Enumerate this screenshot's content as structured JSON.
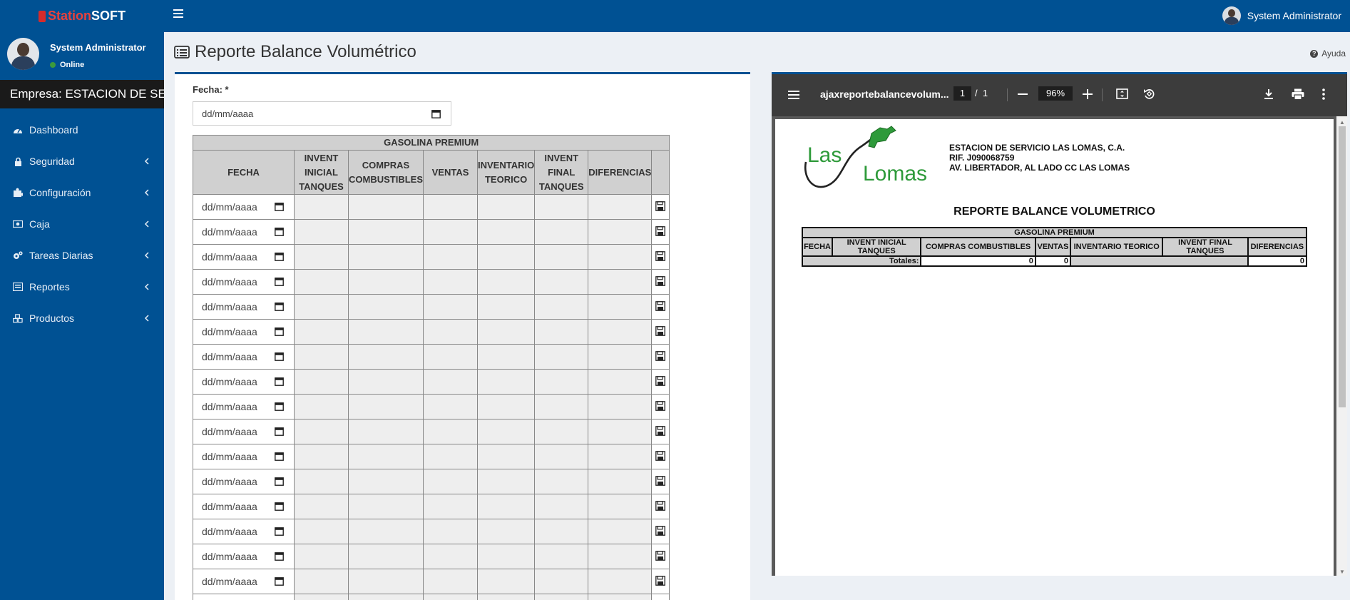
{
  "brand": {
    "logo_part1": "Station",
    "logo_part2": "SOFT"
  },
  "header": {
    "user_name": "System Administrator"
  },
  "sidebar": {
    "user_name": "System Administrator",
    "status": "Online",
    "empresa": "Empresa: ESTACION DE SERVICIO LAS LOMAS, C.A.",
    "items": [
      {
        "label": "Dashboard",
        "icon": "dashboard-icon",
        "has_submenu": false
      },
      {
        "label": "Seguridad",
        "icon": "lock-icon",
        "has_submenu": true
      },
      {
        "label": "Configuración",
        "icon": "puzzle-icon",
        "has_submenu": true
      },
      {
        "label": "Caja",
        "icon": "money-icon",
        "has_submenu": true
      },
      {
        "label": "Tareas Diarias",
        "icon": "cogs-icon",
        "has_submenu": true
      },
      {
        "label": "Reportes",
        "icon": "list-alt-icon",
        "has_submenu": true
      },
      {
        "label": "Productos",
        "icon": "cubes-icon",
        "has_submenu": true
      }
    ]
  },
  "page": {
    "title": "Reporte Balance Volumétrico",
    "help_label": "Ayuda"
  },
  "form": {
    "fecha_label": "Fecha: *",
    "fecha_placeholder": "dd/mm/aaaa"
  },
  "table": {
    "group_title": "GASOLINA PREMIUM",
    "columns": [
      "FECHA",
      "INVENT INICIAL TANQUES",
      "COMPRAS COMBUSTIBLES",
      "VENTAS",
      "INVENTARIO TEORICO",
      "INVENT FINAL TANQUES",
      "DIFERENCIAS"
    ],
    "row_placeholder": "dd/mm/aaaa",
    "row_count": 17
  },
  "pdf": {
    "filename": "ajaxreportebalancevolum...",
    "page_current": "1",
    "page_separator": "/",
    "page_total": "1",
    "zoom": "96%",
    "logo_text_1": "Las",
    "logo_text_2": "Lomas",
    "company_name": "ESTACION DE SERVICIO LAS LOMAS, C.A.",
    "company_rif": "RIF. J090068759",
    "company_address": "AV. LIBERTADOR, AL LADO CC LAS LOMAS",
    "report_title": "REPORTE BALANCE VOLUMETRICO",
    "table_group_title": "GASOLINA PREMIUM",
    "table_columns": [
      "FECHA",
      "INVENT INICIAL TANQUES",
      "COMPRAS COMBUSTIBLES",
      "VENTAS",
      "INVENTARIO TEORICO",
      "INVENT FINAL TANQUES",
      "DIFERENCIAS"
    ],
    "totals_label": "Totales:",
    "total_compras": "0",
    "total_ventas": "0",
    "total_diferencias": "0"
  },
  "colors": {
    "primary": "#005193",
    "empresa_bar": "#1a1a1a",
    "logo_accent": "#e8413c",
    "pdf_toolbar": "#3c3c3c",
    "lomas_green": "#2e9a3a"
  }
}
